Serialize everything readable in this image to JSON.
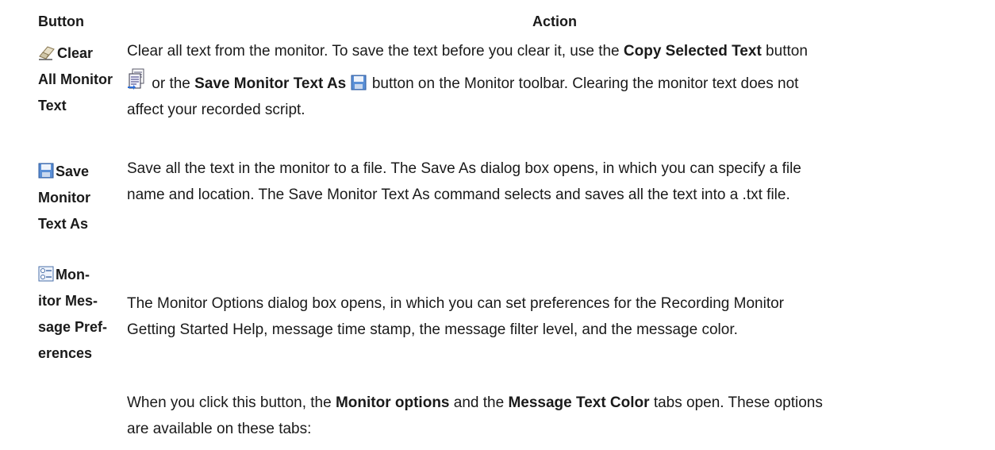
{
  "table": {
    "headers": {
      "button": "Button",
      "action": "Action"
    },
    "rows": [
      {
        "button_label": [
          "Clear",
          "All Monitor",
          "Text"
        ],
        "button_icon": "eraser-icon",
        "action_parts": [
          "Clear all text from the monitor. To save the text before you clear it, use the ",
          "Copy Selected Text",
          " button",
          " or the ",
          "Save Monitor Text As",
          " button on the Monitor toolbar. Clearing the monitor text does not",
          "affect your recorded script."
        ]
      },
      {
        "button_label": [
          "Save",
          "Monitor",
          "Text As"
        ],
        "button_icon": "save-icon",
        "action_lines": [
          "Save all the text in the monitor to a file. The Save As dialog box opens, in which you can specify a file",
          "name and location. The Save Monitor Text As command selects and saves all the text into a .txt file."
        ]
      },
      {
        "button_label": [
          "Mon-",
          "itor Mes-",
          "sage Pref-",
          "erences"
        ],
        "button_icon": "preferences-icon",
        "action_lines": [
          "The Monitor Options dialog box opens, in which you can set preferences for the Recording Monitor",
          "Getting Started Help, message time stamp, the message filter level, and the message color."
        ],
        "action_parts2": [
          "When you click this button, the ",
          "Monitor options",
          " and the ",
          "Message Text Color",
          " tabs open. These options",
          "are available on these tabs:"
        ]
      }
    ]
  },
  "icons": {
    "eraser": "eraser-icon",
    "copy": "copy-selected-text-icon",
    "save": "save-icon",
    "preferences": "preferences-icon"
  }
}
